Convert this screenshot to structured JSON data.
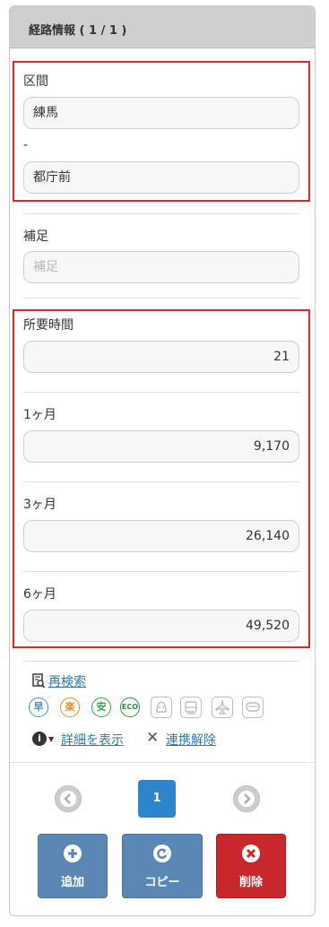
{
  "panel": {
    "title": "経路情報 ( 1 / 1 )"
  },
  "section": {
    "label": "区間",
    "from": "練馬",
    "dash": "-",
    "to": "都庁前"
  },
  "supplement": {
    "label": "補足",
    "placeholder": "補足"
  },
  "fields": [
    {
      "label": "所要時間",
      "value": "21"
    },
    {
      "label": "1ヶ月",
      "value": "9,170"
    },
    {
      "label": "3ヶ月",
      "value": "26,140"
    },
    {
      "label": "6ヶ月",
      "value": "49,520"
    }
  ],
  "links": {
    "research": "再検索",
    "details": "詳細を表示",
    "unlink": "連携解除"
  },
  "route_icons": [
    {
      "label": "早",
      "color": "#3d8ed6"
    },
    {
      "label": "楽",
      "color": "#f08a24"
    },
    {
      "label": "安",
      "color": "#2fa34a"
    },
    {
      "label": "ECO",
      "color": "#2a8a3c"
    }
  ],
  "pager": {
    "current": "1"
  },
  "actions": {
    "add": "追加",
    "copy": "コピー",
    "delete": "削除"
  },
  "colors": {
    "accent": "#2d86cb",
    "danger": "#c8282b",
    "button": "#5b87b4",
    "highlight": "#d42c2c"
  }
}
